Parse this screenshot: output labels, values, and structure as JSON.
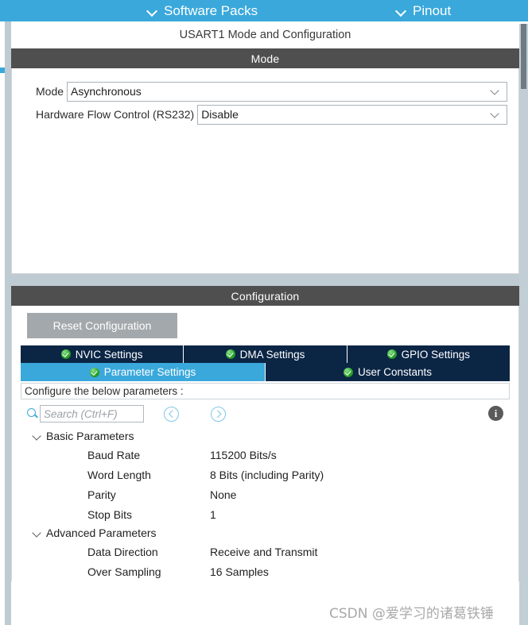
{
  "topbar": {
    "items": [
      {
        "label": "Software Packs",
        "icon": "chevron-down-icon"
      },
      {
        "label": "Pinout",
        "icon": "chevron-down-icon"
      }
    ]
  },
  "peripheral": {
    "title": "USART1 Mode and Configuration"
  },
  "mode_section": {
    "header": "Mode",
    "fields": [
      {
        "label": "Mode",
        "value": "Asynchronous"
      },
      {
        "label": "Hardware Flow Control (RS232)",
        "value": "Disable"
      }
    ]
  },
  "configuration_section": {
    "header": "Configuration",
    "reset_button": "Reset Configuration",
    "tabs_row1": [
      {
        "label": "NVIC Settings",
        "active": false
      },
      {
        "label": "DMA Settings",
        "active": false
      },
      {
        "label": "GPIO Settings",
        "active": false
      }
    ],
    "tabs_row2": [
      {
        "label": "Parameter Settings",
        "active": true
      },
      {
        "label": "User Constants",
        "active": false
      }
    ],
    "hint": "Configure the below parameters :",
    "search": {
      "placeholder": "Search (Ctrl+F)",
      "value": ""
    },
    "info_glyph": "i"
  },
  "parameters": {
    "groups": [
      {
        "name": "Basic Parameters",
        "expanded": true,
        "rows": [
          {
            "name": "Baud Rate",
            "value": "115200 Bits/s"
          },
          {
            "name": "Word Length",
            "value": "8 Bits (including Parity)"
          },
          {
            "name": "Parity",
            "value": "None"
          },
          {
            "name": "Stop Bits",
            "value": "1"
          }
        ]
      },
      {
        "name": "Advanced Parameters",
        "expanded": true,
        "rows": [
          {
            "name": "Data Direction",
            "value": "Receive and Transmit"
          },
          {
            "name": "Over Sampling",
            "value": "16 Samples"
          }
        ]
      }
    ]
  },
  "watermark": "CSDN @爱学习的诸葛铁锤",
  "colors": {
    "accent_blue": "#3aa8db",
    "tab_navy": "#0b2545",
    "section_gray": "#4f4f4f",
    "panel_edge": "#bfcbd2",
    "check_green": "#2aa62a"
  }
}
